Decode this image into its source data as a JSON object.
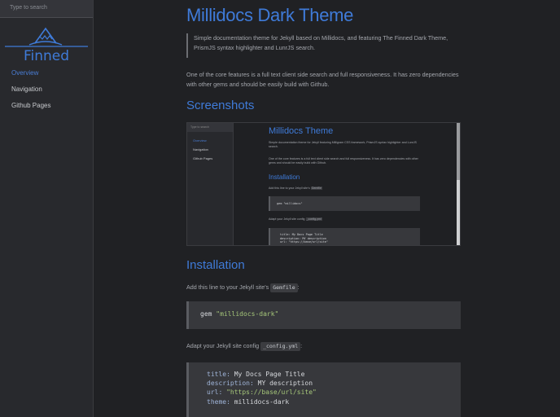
{
  "sidebar": {
    "search_placeholder": "Type to search",
    "logo_text": "Finned",
    "items": [
      {
        "label": "Overview",
        "active": true
      },
      {
        "label": "Navigation",
        "active": false
      },
      {
        "label": "Github Pages",
        "active": false
      }
    ]
  },
  "main": {
    "title": "Millidocs Dark Theme",
    "intro": "Simple documentation theme for Jekyll based on Millidocs, and featuring The Finned Dark Theme, PrismJS syntax highlighter and LunrJS search.",
    "features": "One of the core features is a full text client side search and full responsiveness. It has zero dependencies with other gems and should be easily build with Github.",
    "screenshots_heading": "Screenshots",
    "installation_heading": "Installation",
    "add_line_prefix": "Add this line to your Jekyll site's",
    "gemfile": "Gemfile",
    "add_line_suffix": ":",
    "gem_keyword": "gem",
    "gem_name": "\"millidocs-dark\"",
    "adapt_prefix": "Adapt your Jekyll site config",
    "config_file": "_config.yml",
    "adapt_suffix": ":",
    "config": {
      "title_key": "title:",
      "title_val": "My Docs Page Title",
      "desc_key": "description:",
      "desc_val": "MY description",
      "url_key": "url:",
      "url_val": "\"https://base/url/site\"",
      "theme_key": "theme:",
      "theme_val": "millidocs-dark"
    }
  },
  "screenshot": {
    "search_placeholder": "Type to search",
    "nav": [
      "Overview",
      "Navigation",
      "Github Pages"
    ],
    "title": "Millidocs Theme",
    "intro": "Simple documentation theme for Jekyll featuring Milligram CSS framework, PrismJS syntax highlighter and LunrJS search.",
    "features": "One of the core features is a full text client side search and full responsiveness. It has zero dependencies with other gems and should be easily build with Github.",
    "install_heading": "Installation",
    "add_line": "Add this line to your Jekyll site's",
    "gemfile": "Gemfile",
    "gem_line": "gem \"millidocs\"",
    "adapt_line": "Adapt your Jekyll site config",
    "config_file": "_config.yml",
    "cfg1": "title: My Docs Page Title",
    "cfg2": "description: MY description",
    "cfg3": "url: \"https://base/url/site\""
  },
  "colors": {
    "accent": "#3f7bd9",
    "background": "#202124",
    "sidebar": "#28292d",
    "code_bg": "#37383c",
    "string": "#a6c77a"
  }
}
